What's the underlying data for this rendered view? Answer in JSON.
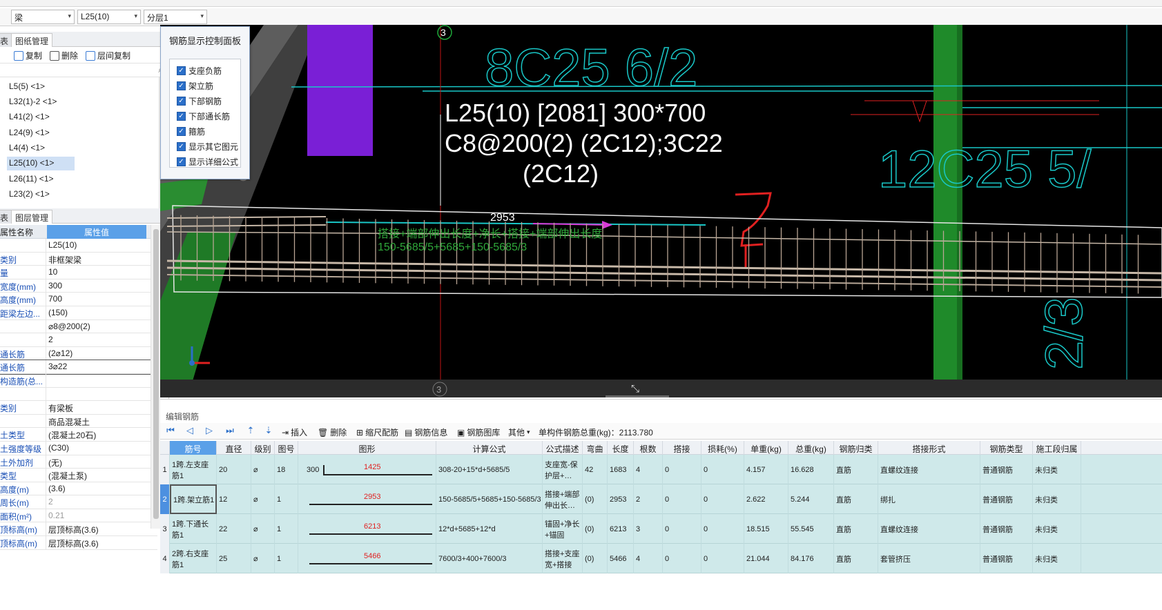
{
  "selectors": {
    "type": "梁",
    "component": "L25(10)",
    "layer": "分层1"
  },
  "component_panel": {
    "tabs": [
      "表",
      "图纸管理"
    ],
    "close": "×",
    "toolbar": {
      "copy": "复制",
      "delete": "删除",
      "floor_copy": "层间复制"
    },
    "items": [
      {
        "label": "L5(5) <1>"
      },
      {
        "label": "L32(1)-2 <1>"
      },
      {
        "label": "L41(2) <1>"
      },
      {
        "label": "L24(9) <1>"
      },
      {
        "label": "L4(4) <1>"
      },
      {
        "label": "L25(10) <1>"
      },
      {
        "label": "L26(11) <1>"
      },
      {
        "label": "L23(2) <1>"
      }
    ],
    "selected_index": 5
  },
  "property_panel": {
    "tabs": [
      "表",
      "图层管理"
    ],
    "close": "×",
    "col_name": "属性名称",
    "col_value": "属性值",
    "rows": [
      {
        "name": "",
        "value": "L25(10)"
      },
      {
        "name": "类别",
        "value": "非框架梁"
      },
      {
        "name": "量",
        "value": "10"
      },
      {
        "name": "宽度(mm)",
        "value": "300"
      },
      {
        "name": "高度(mm)",
        "value": "700"
      },
      {
        "name": "距梁左边...",
        "value": "(150)"
      },
      {
        "name": "",
        "value": "⌀8@200(2)"
      },
      {
        "name": "",
        "value": "2"
      },
      {
        "name": "通长筋",
        "value": "(2⌀12)"
      },
      {
        "name": "通长筋",
        "value": "3⌀22"
      },
      {
        "name": "构造筋(总...",
        "value": ""
      },
      {
        "name": "",
        "value": ""
      },
      {
        "name": "类别",
        "value": "有梁板"
      },
      {
        "name": "",
        "value": "商品混凝土"
      },
      {
        "name": "土类型",
        "value": "(混凝土20石)"
      },
      {
        "name": "土强度等级",
        "value": "(C30)"
      },
      {
        "name": "土外加剂",
        "value": "(无)"
      },
      {
        "name": "类型",
        "value": "(混凝土泵)"
      },
      {
        "name": "高度(m)",
        "value": "(3.6)"
      },
      {
        "name": "周长(m)",
        "value": "2"
      },
      {
        "name": "面积(m²)",
        "value": "0.21"
      },
      {
        "name": "顶标高(m)",
        "value": "层顶标高(3.6)"
      },
      {
        "name": "顶标高(m)",
        "value": "层顶标高(3.6)"
      }
    ]
  },
  "rebar_panel": {
    "title": "钢筋显示控制面板",
    "options": [
      "支座负筋",
      "架立筋",
      "下部钢筋",
      "下部通长筋",
      "箍筋",
      "显示其它图元",
      "显示详细公式"
    ]
  },
  "viewport": {
    "axis_label": "3",
    "beam_label_line1": "L25(10) [2081] 300*700",
    "beam_label_line2": "C8@200(2) (2C12);3C22",
    "beam_label_line3": "(2C12)",
    "bg_text_1": "8C25 6/2",
    "bg_text_2": "12C25 5/",
    "bg_text_3": "2/3",
    "dim": "2953",
    "formula_line1": "搭接+端部伸出长度+净长+搭接+端部伸出长度",
    "formula_line2": "150-5685/5+5685+150-5685/3",
    "partial_label": "0",
    "colors": {
      "background": "#000000",
      "cyan": "#19c7c7",
      "green_column": "#1f8a2a",
      "purple": "#7a1fd6",
      "red": "#e02020",
      "formula_green": "#2fa83a"
    }
  },
  "edit_rebar": {
    "title": "编辑钢筋",
    "toolbar": {
      "insert": "插入",
      "delete": "删除",
      "scale": "缩尺配筋",
      "info": "钢筋信息",
      "library": "钢筋图库",
      "other": "其他",
      "total_weight": "单构件钢筋总重(kg)：2113.780"
    },
    "columns": [
      "筋号",
      "直径(mm)",
      "级别",
      "图号",
      "图形",
      "计算公式",
      "公式描述",
      "弯曲调整",
      "长度",
      "根数",
      "搭接",
      "损耗(%)",
      "单重(kg)",
      "总重(kg)",
      "钢筋归类",
      "搭接形式",
      "钢筋类型",
      "施工段归属"
    ],
    "rows": [
      {
        "idx": "1",
        "name": "1跨.左支座筋1",
        "dia": "20",
        "grade": "⌀",
        "fig": "18",
        "shape_left": "300",
        "shape_num": "1425",
        "formula": "308-20+15*d+5685/5",
        "desc": "支座宽-保护层+…",
        "bend": "42",
        "length": "1683",
        "count": "4",
        "lap": "0",
        "loss": "0",
        "unit_w": "4.157",
        "total_w": "16.628",
        "cls": "直筋",
        "lap_type": "直螺纹连接",
        "rtype": "普通钢筋",
        "seg": "未归类"
      },
      {
        "idx": "2",
        "name": "1跨.架立筋1",
        "dia": "12",
        "grade": "⌀",
        "fig": "1",
        "shape_left": "",
        "shape_num": "2953",
        "formula": "150-5685/5+5685+150-5685/3",
        "desc": "搭接+端部伸出长…",
        "bend": "(0)",
        "length": "2953",
        "count": "2",
        "lap": "0",
        "loss": "0",
        "unit_w": "2.622",
        "total_w": "5.244",
        "cls": "直筋",
        "lap_type": "绑扎",
        "rtype": "普通钢筋",
        "seg": "未归类"
      },
      {
        "idx": "3",
        "name": "1跨.下通长筋1",
        "dia": "22",
        "grade": "⌀",
        "fig": "1",
        "shape_left": "",
        "shape_num": "6213",
        "formula": "12*d+5685+12*d",
        "desc": "锚固+净长+锚固",
        "bend": "(0)",
        "length": "6213",
        "count": "3",
        "lap": "0",
        "loss": "0",
        "unit_w": "18.515",
        "total_w": "55.545",
        "cls": "直筋",
        "lap_type": "直螺纹连接",
        "rtype": "普通钢筋",
        "seg": "未归类"
      },
      {
        "idx": "4",
        "name": "2跨.右支座筋1",
        "dia": "25",
        "grade": "⌀",
        "fig": "1",
        "shape_left": "",
        "shape_num": "5466",
        "formula": "7600/3+400+7600/3",
        "desc": "搭接+支座宽+搭接",
        "bend": "(0)",
        "length": "5466",
        "count": "4",
        "lap": "0",
        "loss": "0",
        "unit_w": "21.044",
        "total_w": "84.176",
        "cls": "直筋",
        "lap_type": "套管挤压",
        "rtype": "普通钢筋",
        "seg": "未归类"
      }
    ],
    "selected_row": 1
  }
}
